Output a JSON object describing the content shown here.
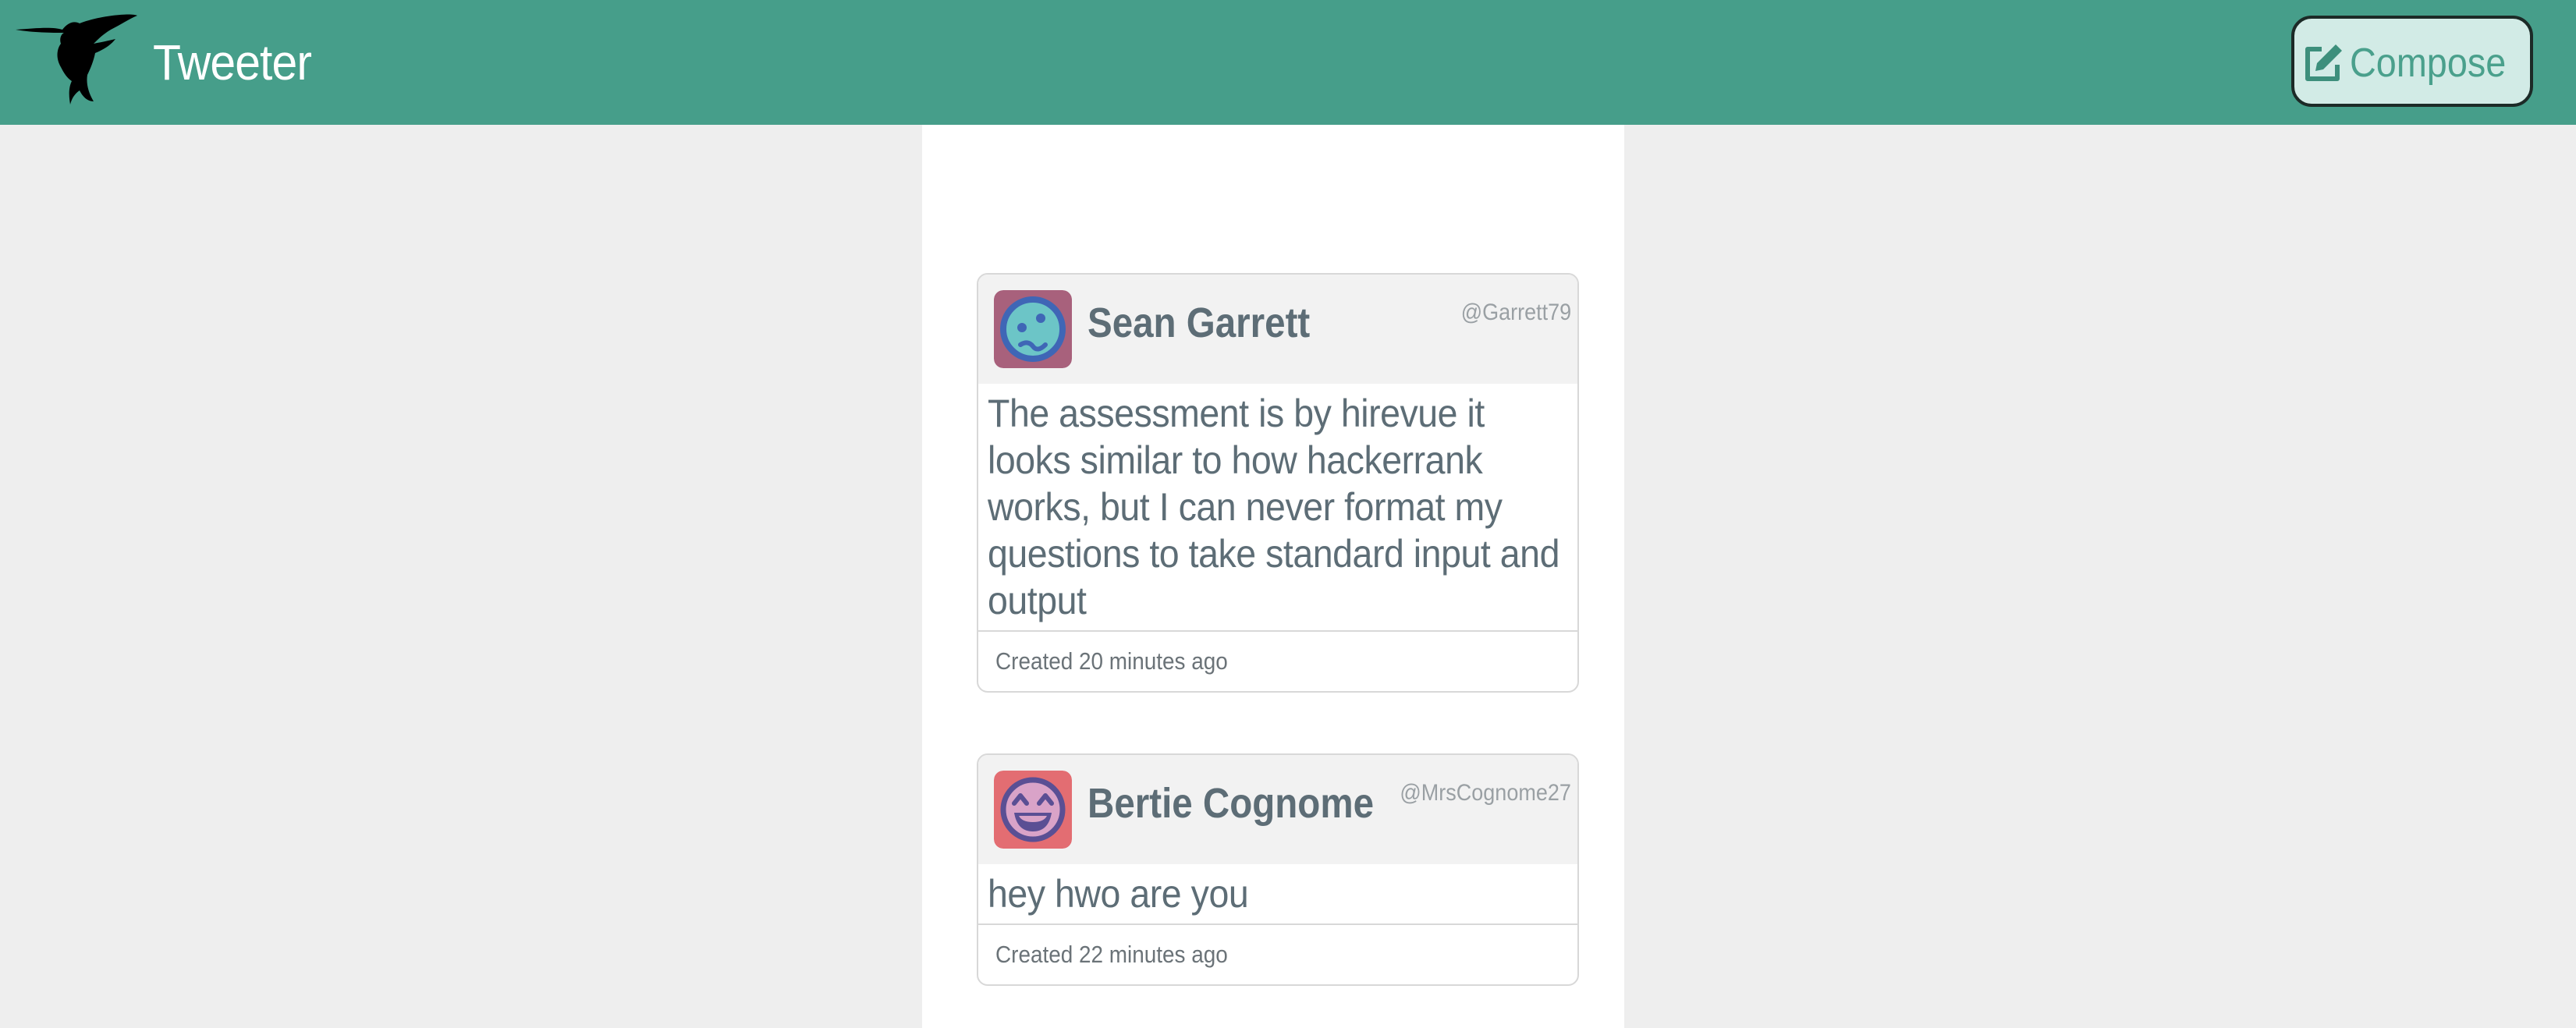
{
  "header": {
    "app_title": "Tweeter",
    "logo_icon": "hummingbird-icon",
    "compose_label": "Compose",
    "compose_icon": "edit-square-icon",
    "bar_color": "#469e8a"
  },
  "tweets": [
    {
      "name": "Sean Garrett",
      "handle": "@Garrett79",
      "avatar_icon": "smiley-face-avatar-icon",
      "text": "The assessment is by hirevue it looks similar to how hackerrank works, but I can never format my questions to take standard input and output",
      "created": "Created 20 minutes ago"
    },
    {
      "name": "Bertie Cognome",
      "handle": "@MrsCognome27",
      "avatar_icon": "laughing-face-avatar-icon",
      "text": "hey hwo are you",
      "created": "Created 22 minutes ago"
    }
  ]
}
